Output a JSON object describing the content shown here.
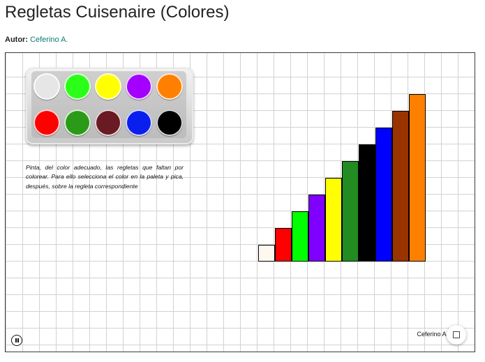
{
  "page": {
    "title": "Regletas Cuisenaire (Colores)",
    "author_label": "Autor:",
    "author_name": "Ceferino A."
  },
  "activity": {
    "instructions": "Pinta, del color adecuado, las regletas que faltan por colorear. Para ello selecciona el color en la paleta y pica, después, sobre la regleta correspondiente",
    "credit": "Ceferino A.",
    "palette": [
      {
        "name": "white",
        "color": "#e6e6e6"
      },
      {
        "name": "lime",
        "color": "#2bff17"
      },
      {
        "name": "yellow",
        "color": "#ffff00"
      },
      {
        "name": "purple",
        "color": "#a300ff"
      },
      {
        "name": "orange",
        "color": "#ff8000"
      },
      {
        "name": "red",
        "color": "#ff0000"
      },
      {
        "name": "green",
        "color": "#2a9a18"
      },
      {
        "name": "maroon",
        "color": "#6a1a22"
      },
      {
        "name": "blue",
        "color": "#0a1fee"
      },
      {
        "name": "black",
        "color": "#000000"
      }
    ],
    "rods": [
      {
        "length": 1,
        "color": "#fff8ef"
      },
      {
        "length": 2,
        "color": "#ff0000"
      },
      {
        "length": 3,
        "color": "#00ff00"
      },
      {
        "length": 4,
        "color": "#8000ff"
      },
      {
        "length": 5,
        "color": "#ffff00"
      },
      {
        "length": 6,
        "color": "#228b22"
      },
      {
        "length": 7,
        "color": "#000000"
      },
      {
        "length": 8,
        "color": "#0000ff"
      },
      {
        "length": 9,
        "color": "#993300"
      },
      {
        "length": 10,
        "color": "#ff8000"
      }
    ]
  }
}
